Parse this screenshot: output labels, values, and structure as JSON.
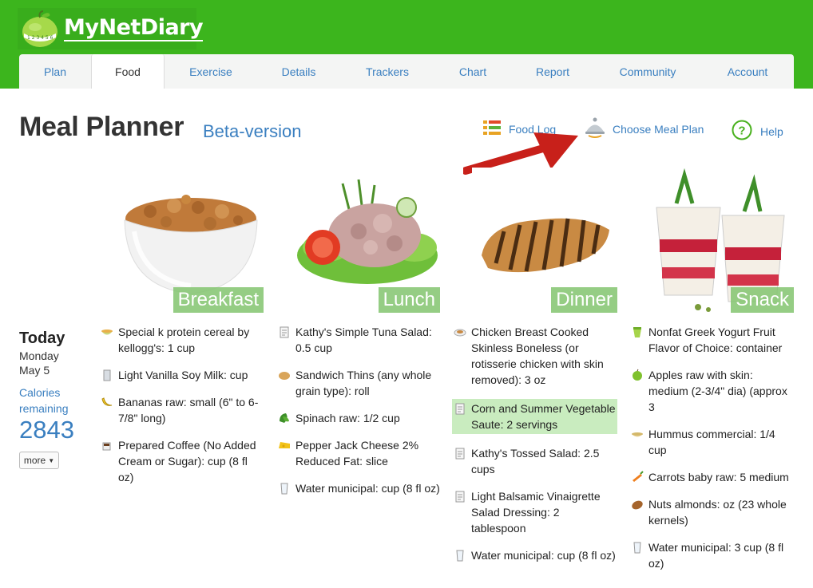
{
  "app": {
    "logo_text": "MyNetDiary"
  },
  "tabs": [
    {
      "label": "Plan"
    },
    {
      "label": "Food",
      "active": true
    },
    {
      "label": "Exercise"
    },
    {
      "label": "Details"
    },
    {
      "label": "Trackers"
    },
    {
      "label": "Chart"
    },
    {
      "label": "Report"
    },
    {
      "label": "Community"
    },
    {
      "label": "Account"
    }
  ],
  "page": {
    "title": "Meal Planner",
    "subtitle": "Beta-version"
  },
  "links": {
    "food_log": "Food Log",
    "choose_meal_plan": "Choose Meal Plan",
    "help": "Help"
  },
  "meals": [
    {
      "label": "Breakfast"
    },
    {
      "label": "Lunch"
    },
    {
      "label": "Dinner"
    },
    {
      "label": "Snack"
    }
  ],
  "today": {
    "title": "Today",
    "day": "Monday",
    "date": "May 5",
    "calories_label": "Calories remaining",
    "calories_value": "2843",
    "more_label": "more"
  },
  "breakfast_items": [
    {
      "text": "Special k protein cereal by kellogg's: 1 cup",
      "icon": "cereal-icon"
    },
    {
      "text": "Light Vanilla Soy Milk: cup",
      "icon": "milk-icon"
    },
    {
      "text": "Bananas raw: small (6\" to 6-7/8\" long)",
      "icon": "banana-icon"
    },
    {
      "text": "Prepared Coffee (No Added Cream or Sugar): cup (8 fl oz)",
      "icon": "coffee-icon"
    }
  ],
  "lunch_items": [
    {
      "text": "Kathy's Simple Tuna Salad: 0.5 cup",
      "icon": "recipe-icon"
    },
    {
      "text": "Sandwich Thins (any whole grain type): roll",
      "icon": "bread-icon"
    },
    {
      "text": "Spinach raw: 1/2 cup",
      "icon": "spinach-icon"
    },
    {
      "text": "Pepper Jack Cheese 2% Reduced Fat: slice",
      "icon": "cheese-icon"
    },
    {
      "text": "Water municipal: cup (8 fl oz)",
      "icon": "water-icon"
    }
  ],
  "dinner_items": [
    {
      "text": "Chicken Breast Cooked Skinless Boneless (or rotisserie chicken with skin removed): 3 oz",
      "icon": "chicken-icon"
    },
    {
      "text": "Corn and Summer Vegetable Saute: 2 servings",
      "icon": "recipe-icon",
      "highlight": true
    },
    {
      "text": "Kathy's Tossed Salad: 2.5 cups",
      "icon": "recipe-icon"
    },
    {
      "text": "Light Balsamic Vinaigrette Salad Dressing: 2 tablespoon",
      "icon": "recipe-icon"
    },
    {
      "text": "Water municipal: cup (8 fl oz)",
      "icon": "water-icon"
    }
  ],
  "snack_items": [
    {
      "text": "Nonfat Greek Yogurt Fruit Flavor of Choice: container",
      "icon": "yogurt-icon"
    },
    {
      "text": "Apples raw with skin: medium (2-3/4\" dia) (approx 3",
      "icon": "apple-icon"
    },
    {
      "text": "Hummus commercial: 1/4 cup",
      "icon": "hummus-icon"
    },
    {
      "text": "Carrots baby raw: 5 medium",
      "icon": "carrot-icon"
    },
    {
      "text": "Nuts almonds: oz (23 whole kernels)",
      "icon": "almond-icon"
    },
    {
      "text": "Water municipal: 3 cup (8 fl oz)",
      "icon": "water-icon"
    }
  ]
}
